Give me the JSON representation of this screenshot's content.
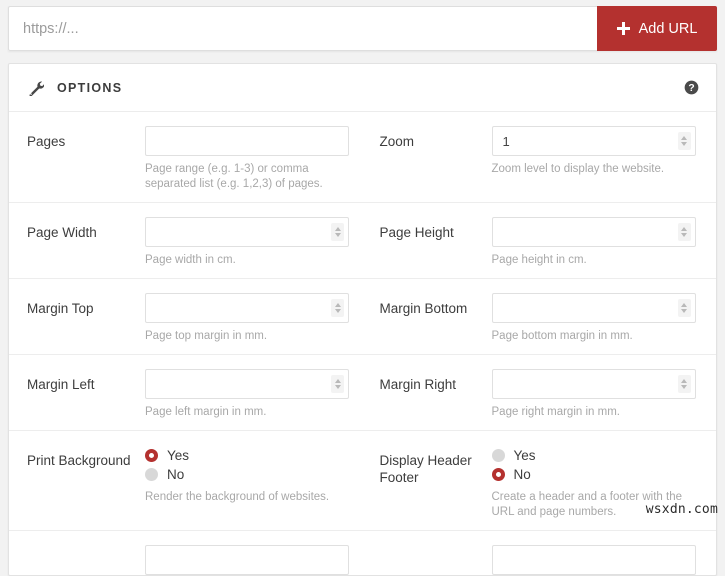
{
  "url_bar": {
    "input_placeholder": "https://...",
    "input_value": "",
    "add_button_label": "Add URL",
    "add_button_icon": "plus-icon",
    "accent_color": "#b4312f"
  },
  "panel": {
    "title": "OPTIONS",
    "wrench_icon": "wrench-icon",
    "help_icon": "help-circle-icon",
    "rows": [
      {
        "left": {
          "label": "Pages",
          "value": "",
          "spinner": false,
          "hint": "Page range (e.g. 1-3) or comma separated list (e.g. 1,2,3) of pages."
        },
        "right": {
          "label": "Zoom",
          "value": "1",
          "spinner": true,
          "hint": "Zoom level to display the website."
        }
      },
      {
        "left": {
          "label": "Page Width",
          "value": "",
          "spinner": true,
          "hint": "Page width in cm."
        },
        "right": {
          "label": "Page Height",
          "value": "",
          "spinner": true,
          "hint": "Page height in cm."
        }
      },
      {
        "left": {
          "label": "Margin Top",
          "value": "",
          "spinner": true,
          "hint": "Page top margin in mm."
        },
        "right": {
          "label": "Margin Bottom",
          "value": "",
          "spinner": true,
          "hint": "Page bottom margin in mm."
        }
      },
      {
        "left": {
          "label": "Margin Left",
          "value": "",
          "spinner": true,
          "hint": "Page left margin in mm."
        },
        "right": {
          "label": "Margin Right",
          "value": "",
          "spinner": true,
          "hint": "Page right margin in mm."
        }
      }
    ],
    "radio_row": {
      "left": {
        "label": "Print Background",
        "yes_label": "Yes",
        "no_label": "No",
        "selected": "Yes",
        "hint": "Render the background of websites."
      },
      "right": {
        "label": "Display Header Footer",
        "yes_label": "Yes",
        "no_label": "No",
        "selected": "No",
        "hint": "Create a header and a footer with the URL and page numbers."
      }
    }
  },
  "watermark": "wsxdn.com"
}
